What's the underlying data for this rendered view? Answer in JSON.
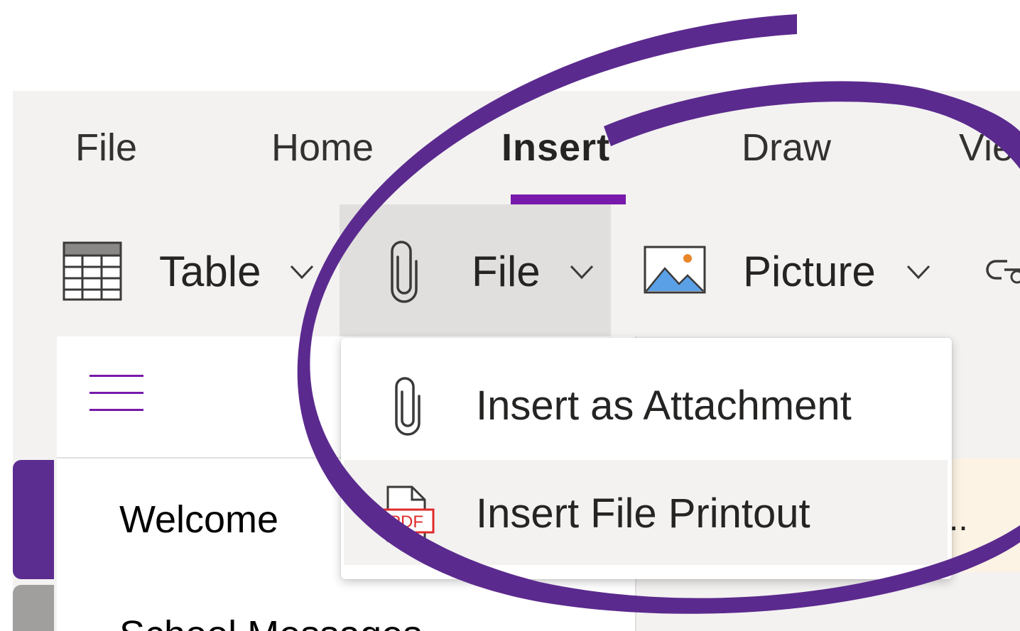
{
  "tabs": [
    {
      "label": "File"
    },
    {
      "label": "Home"
    },
    {
      "label": "Insert",
      "active": true
    },
    {
      "label": "Draw"
    },
    {
      "label": "View"
    }
  ],
  "ribbon": {
    "table": {
      "label": "Table",
      "icon": "table-icon"
    },
    "file": {
      "label": "File",
      "icon": "paperclip-icon",
      "pressed": true
    },
    "picture": {
      "label": "Picture",
      "icon": "picture-icon"
    },
    "link": {
      "icon": "link-icon"
    }
  },
  "file_menu": {
    "items": [
      {
        "label": "Insert as Attachment",
        "icon": "paperclip-icon"
      },
      {
        "label": "Insert File Printout",
        "icon": "pdf-icon",
        "pdf_text": "PDF",
        "highlighted": true
      }
    ]
  },
  "navigation": {
    "menu_icon": "hamburger-icon",
    "pages": [
      {
        "label": "Welcome",
        "selected": true
      },
      {
        "label": "School Messages"
      }
    ],
    "truncation": ".."
  },
  "colors": {
    "accent": "#7719aa",
    "annotation_swirl": "#5b2a8e",
    "section_tab": "#5c2d91",
    "ribbon_bg": "#f3f2f1",
    "pressed_bg": "#e1dfdd",
    "pdf_red": "#e02b2b"
  }
}
